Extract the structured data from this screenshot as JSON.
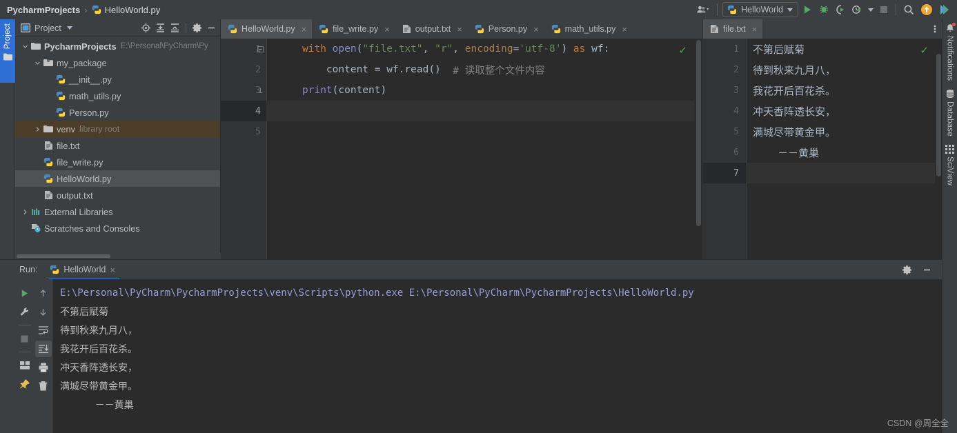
{
  "titlebar": {
    "breadcrumb_root": "PycharmProjects",
    "breadcrumb_sep": "›",
    "breadcrumb_file": "HelloWorld.py",
    "run_config": "HelloWorld",
    "icons": [
      "user-group-icon",
      "run-icon",
      "debug-icon",
      "coverage-icon",
      "profile-icon",
      "stop-icon",
      "search-icon",
      "update-icon",
      "datalore-icon"
    ]
  },
  "left_strip": {
    "project_tab": "Project"
  },
  "project_panel": {
    "title": "Project",
    "tools": [
      "locate-icon",
      "expand-all-icon",
      "collapse-all-icon",
      "gear-icon",
      "minimize-icon"
    ],
    "tree": [
      {
        "label": "PycharmProjects",
        "sub": "E:\\Personal\\PyCharm\\Py",
        "icon": "folder-icon",
        "twist": "down",
        "indent": 0,
        "bold": true,
        "state": "normal"
      },
      {
        "label": "my_package",
        "sub": "",
        "icon": "package-folder-icon",
        "twist": "down",
        "indent": 1,
        "bold": false,
        "state": "normal"
      },
      {
        "label": "__init__.py",
        "sub": "",
        "icon": "python-file-icon",
        "twist": "none",
        "indent": 2,
        "bold": false,
        "state": "normal"
      },
      {
        "label": "math_utils.py",
        "sub": "",
        "icon": "python-file-icon",
        "twist": "none",
        "indent": 2,
        "bold": false,
        "state": "normal"
      },
      {
        "label": "Person.py",
        "sub": "",
        "icon": "python-file-icon",
        "twist": "none",
        "indent": 2,
        "bold": false,
        "state": "normal"
      },
      {
        "label": "venv",
        "sub": "library root",
        "icon": "folder-icon",
        "twist": "right",
        "indent": 1,
        "bold": false,
        "state": "venv"
      },
      {
        "label": "file.txt",
        "sub": "",
        "icon": "text-file-icon",
        "twist": "none",
        "indent": 1,
        "bold": false,
        "state": "normal"
      },
      {
        "label": "file_write.py",
        "sub": "",
        "icon": "python-file-icon",
        "twist": "none",
        "indent": 1,
        "bold": false,
        "state": "normal"
      },
      {
        "label": "HelloWorld.py",
        "sub": "",
        "icon": "python-file-icon",
        "twist": "none",
        "indent": 1,
        "bold": false,
        "state": "selected"
      },
      {
        "label": "output.txt",
        "sub": "",
        "icon": "text-file-icon",
        "twist": "none",
        "indent": 1,
        "bold": false,
        "state": "normal"
      },
      {
        "label": "External Libraries",
        "sub": "",
        "icon": "libraries-icon",
        "twist": "right",
        "indent": 0,
        "bold": false,
        "state": "normal"
      },
      {
        "label": "Scratches and Consoles",
        "sub": "",
        "icon": "scratches-icon",
        "twist": "none",
        "indent": 0,
        "bold": false,
        "state": "normal"
      }
    ]
  },
  "editor": {
    "tabs": [
      {
        "label": "HelloWorld.py",
        "icon": "python-file-icon",
        "active": true
      },
      {
        "label": "file_write.py",
        "icon": "python-file-icon",
        "active": false
      },
      {
        "label": "output.txt",
        "icon": "text-file-icon",
        "active": false
      },
      {
        "label": "Person.py",
        "icon": "python-file-icon",
        "active": false
      },
      {
        "label": "math_utils.py",
        "icon": "python-file-icon",
        "active": false
      }
    ],
    "close_glyph": "×",
    "gutter_lines": [
      "1",
      "2",
      "3",
      "4",
      "5"
    ],
    "current_line": 4,
    "code": {
      "line1": {
        "kw_with": "with ",
        "fn_open": "open",
        "p1": "(",
        "s_file": "\"file.txt\"",
        "c1": ", ",
        "s_r": "\"r\"",
        "c2": ", ",
        "arg_encoding": "encoding",
        "eq": "=",
        "s_utf": "'utf-8'",
        "p2": ")",
        "kw_as": " as ",
        "wf": "wf",
        "colon": ":"
      },
      "line2": {
        "content": "    content = wf.read()",
        "comment": "  # 读取整个文件内容"
      },
      "line3": {
        "fn_print": "print",
        "rest": "(content)"
      }
    },
    "status_check": "✓"
  },
  "right_editor": {
    "tab": {
      "label": "file.txt",
      "icon": "text-file-icon"
    },
    "close_glyph": "×",
    "gutter_lines": [
      "1",
      "2",
      "3",
      "4",
      "5",
      "6",
      "7"
    ],
    "current_line": 7,
    "lines": [
      "不第后赋菊",
      "待到秋来九月八，",
      "我花开后百花杀。",
      "冲天香阵透长安，",
      "满城尽带黄金甲。",
      "    －－黄巢",
      ""
    ],
    "status_check": "✓"
  },
  "right_strip": {
    "tabs": [
      {
        "label": "Notifications",
        "icon": "bell-icon",
        "badge": true
      },
      {
        "label": "Database",
        "icon": "database-icon",
        "badge": false
      },
      {
        "label": "SciView",
        "icon": "sciview-icon",
        "badge": false
      }
    ]
  },
  "run_panel": {
    "label": "Run:",
    "tab": "HelloWorld",
    "tab_icon": "python-icon",
    "close_glyph": "×",
    "header_icons": [
      "gear-icon",
      "minimize-icon"
    ],
    "side_icons_col1": [
      "run-icon",
      "wrench-icon",
      "stop-icon",
      "layout-icon",
      "pin-icon"
    ],
    "side_icons_col2": [
      "arrow-up-icon",
      "arrow-down-icon",
      "soft-wrap-icon",
      "scroll-to-end-icon",
      "print-icon",
      "trash-icon"
    ],
    "console": [
      {
        "text": "E:\\Personal\\PyCharm\\PycharmProjects\\venv\\Scripts\\python.exe E:\\Personal\\PyCharm\\PycharmProjects\\HelloWorld.py",
        "style": "path"
      },
      {
        "text": "不第后赋菊",
        "style": "out"
      },
      {
        "text": "待到秋来九月八，",
        "style": "out"
      },
      {
        "text": "我花开后百花杀。",
        "style": "out"
      },
      {
        "text": "冲天香阵透长安，",
        "style": "out"
      },
      {
        "text": "满城尽带黄金甲。",
        "style": "out"
      },
      {
        "text": "      －－黄巢",
        "style": "out"
      }
    ]
  },
  "watermark": "CSDN @周全全",
  "colors": {
    "bg_chrome": "#3c3f41",
    "bg_editor": "#2b2b2b",
    "accent_blue": "#2f6fd4",
    "keyword_orange": "#cc7832",
    "string_green": "#6a8759",
    "function_purple": "#8888c6",
    "comment_gray": "#808080",
    "selection_gray": "#4e5254",
    "venv_brown": "#4b3d28",
    "run_green": "#4ca64c"
  }
}
